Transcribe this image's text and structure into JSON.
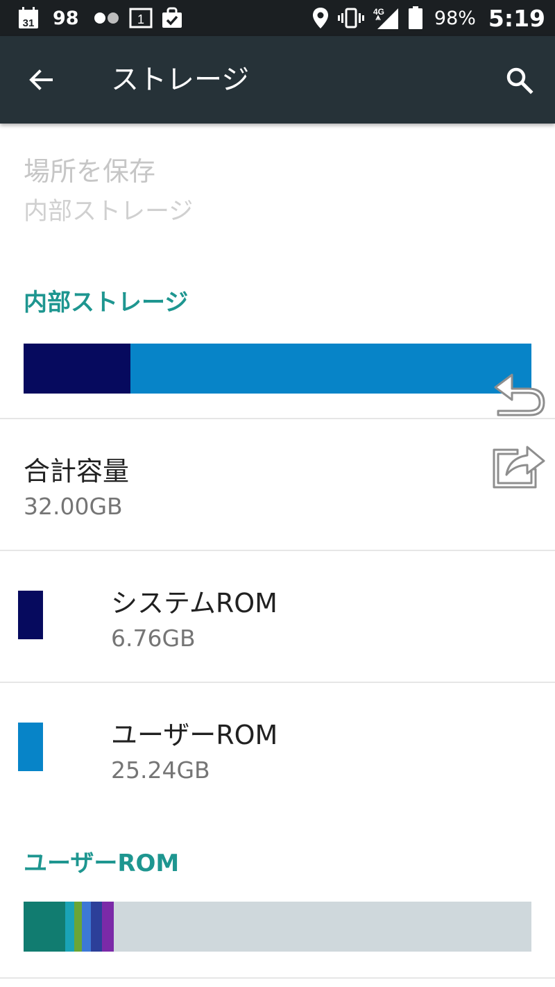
{
  "status_bar": {
    "calendar_day": "31",
    "notification_count": "98",
    "sim_slot": "1",
    "network_type": "4G",
    "battery_percent": "98%",
    "time": "5:19"
  },
  "app_bar": {
    "title": "ストレージ"
  },
  "save_location": {
    "title": "場所を保存",
    "summary": "内部ストレージ"
  },
  "internal_storage": {
    "header": "内部ストレージ",
    "bar_segments": [
      {
        "name": "system",
        "fraction": 0.211,
        "color": "#060a5e"
      },
      {
        "name": "user",
        "fraction": 0.789,
        "color": "#0784c8"
      }
    ],
    "total": {
      "title": "合計容量",
      "value": "32.00GB"
    },
    "items": [
      {
        "title": "システムROM",
        "value": "6.76GB",
        "color": "#060a5e"
      },
      {
        "title": "ユーザーROM",
        "value": "25.24GB",
        "color": "#0784c8"
      }
    ]
  },
  "user_rom": {
    "header": "ユーザーROM",
    "bar_segments": [
      {
        "fraction": 0.082,
        "color": "#117c70"
      },
      {
        "fraction": 0.018,
        "color": "#1aa3b6"
      },
      {
        "fraction": 0.015,
        "color": "#6aa535"
      },
      {
        "fraction": 0.017,
        "color": "#3d78d6"
      },
      {
        "fraction": 0.022,
        "color": "#2c3f99"
      },
      {
        "fraction": 0.023,
        "color": "#7b2aa8"
      },
      {
        "fraction": 0.823,
        "color": "#cfd8dc"
      }
    ]
  },
  "colors": {
    "status_bar": "#1b1f22",
    "app_bar": "#263238",
    "accent": "#1e9690"
  }
}
